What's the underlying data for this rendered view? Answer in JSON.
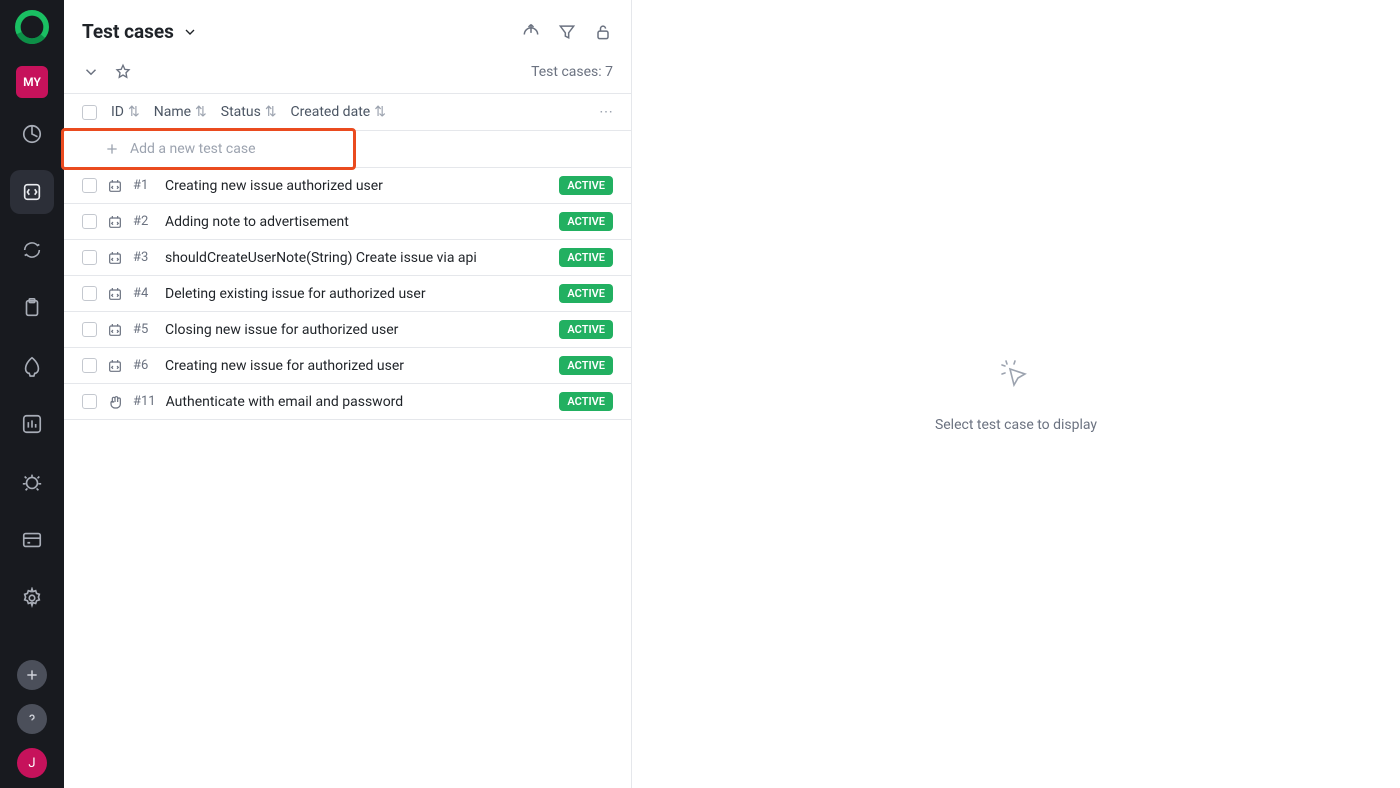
{
  "sidebar": {
    "project_badge": "MY",
    "user_initial": "J"
  },
  "header": {
    "title": "Test cases"
  },
  "subheader": {
    "count_label": "Test cases: 7"
  },
  "columns": {
    "id": "ID",
    "name": "Name",
    "status": "Status",
    "created": "Created date"
  },
  "add_label": "Add a new test case",
  "status_active": "ACTIVE",
  "rows": [
    {
      "id": "#1",
      "name": "Creating new issue authorized user",
      "type": "auto"
    },
    {
      "id": "#2",
      "name": "Adding note to advertisement",
      "type": "auto"
    },
    {
      "id": "#3",
      "name": "shouldCreateUserNote(String) Create issue via api",
      "type": "auto"
    },
    {
      "id": "#4",
      "name": "Deleting existing issue for authorized user",
      "type": "auto"
    },
    {
      "id": "#5",
      "name": "Closing new issue for authorized user",
      "type": "auto"
    },
    {
      "id": "#6",
      "name": "Creating new issue for authorized user",
      "type": "auto"
    },
    {
      "id": "#11",
      "name": "Authenticate with email and password",
      "type": "manual"
    }
  ],
  "empty_state": "Select test case to display"
}
